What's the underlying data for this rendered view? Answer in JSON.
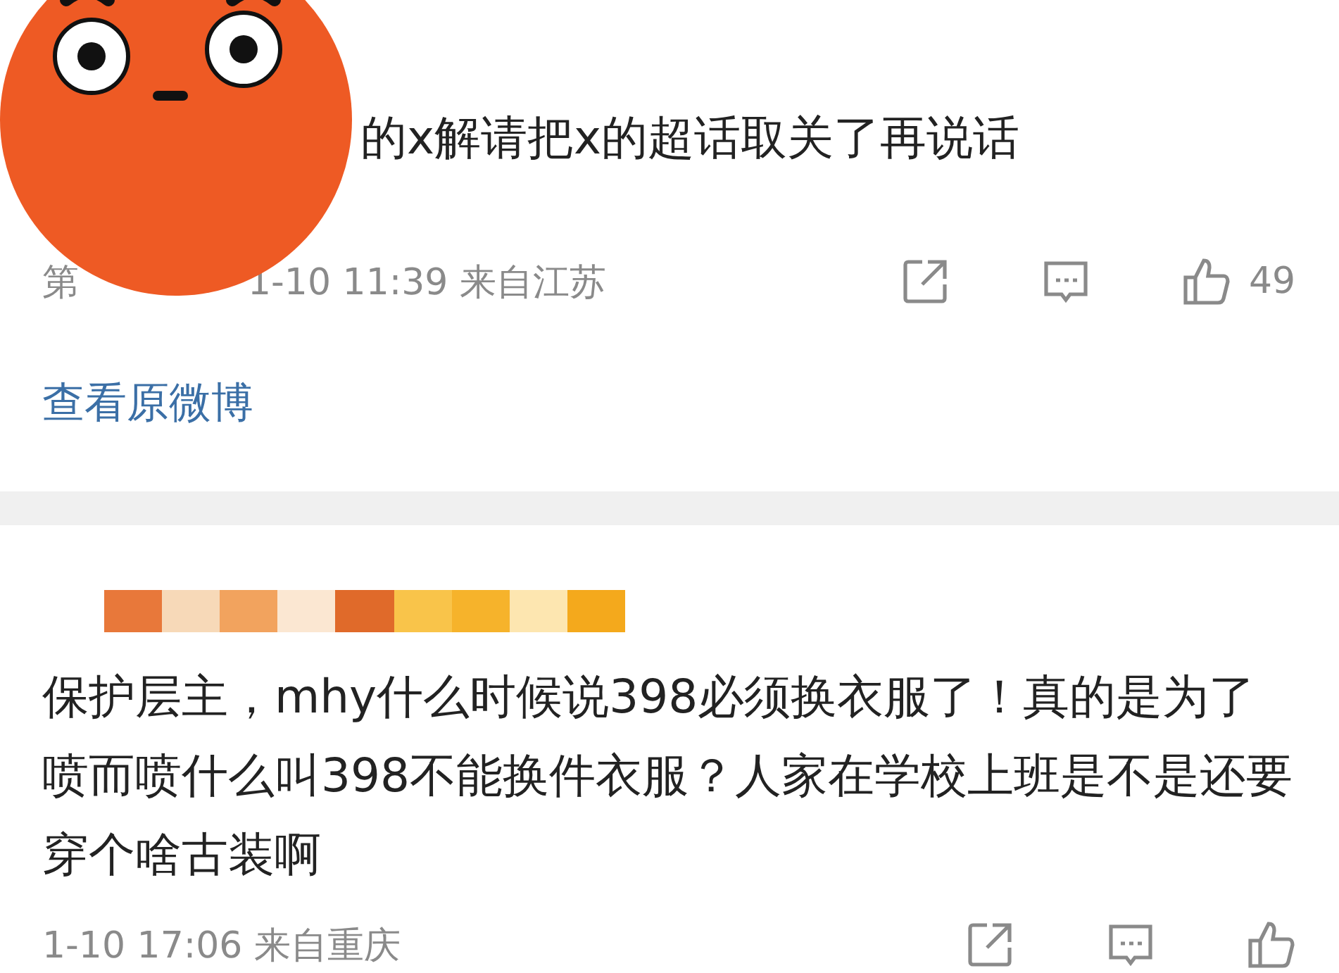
{
  "comments": [
    {
      "text": "的x解请把x的超话取关了再说话",
      "floor_prefix": "第",
      "meta": "1-10 11:39 来自江苏",
      "likes": "49",
      "link": "查看原微博",
      "sticker": true,
      "name_redacted": false
    },
    {
      "text": "保护层主，mhy什么时候说398必须换衣服了！真的是为了喷而喷什么叫398不能换件衣服？人家在学校上班是不是还要穿个啥古装啊",
      "meta": "1-10 17:06 来自重庆",
      "sticker": false,
      "name_redacted": true
    }
  ]
}
